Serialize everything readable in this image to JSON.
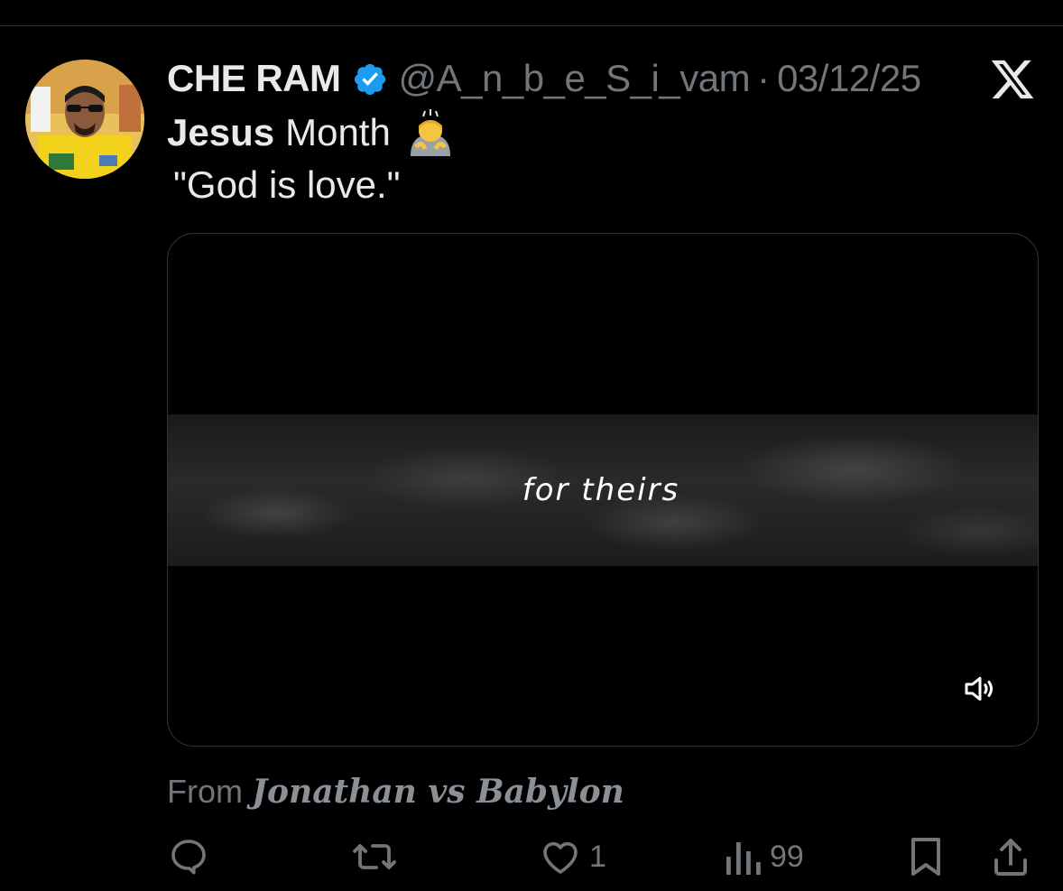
{
  "post": {
    "author": {
      "display_name": "CHE RAM",
      "handle": "@A_n_b_e_S_i_vam",
      "verified_icon": "verified-badge-icon",
      "avatar_icon": "avatar-image"
    },
    "separator": "·",
    "date": "03/12/25",
    "text": {
      "line1_bold": "Jesus",
      "line1_rest": "Month",
      "line1_emoji": "person-bowing-emoji",
      "line2": "\"God is love.\""
    },
    "media": {
      "caption": "for theirs",
      "volume_icon": "volume-icon"
    },
    "from": {
      "label": "From",
      "source": "Jonathan vs Babylon"
    },
    "actions": {
      "reply_icon": "reply-icon",
      "repost_icon": "repost-icon",
      "like_icon": "heart-icon",
      "like_count": "1",
      "views_icon": "views-icon",
      "views_count": "99",
      "bookmark_icon": "bookmark-icon",
      "share_icon": "share-icon"
    },
    "brand_icon": "x-logo-icon"
  },
  "colors": {
    "background": "#000000",
    "text_primary": "#e7e9ea",
    "text_secondary": "#71767b",
    "verified_blue": "#1d9bf0",
    "border": "#2f3336"
  }
}
